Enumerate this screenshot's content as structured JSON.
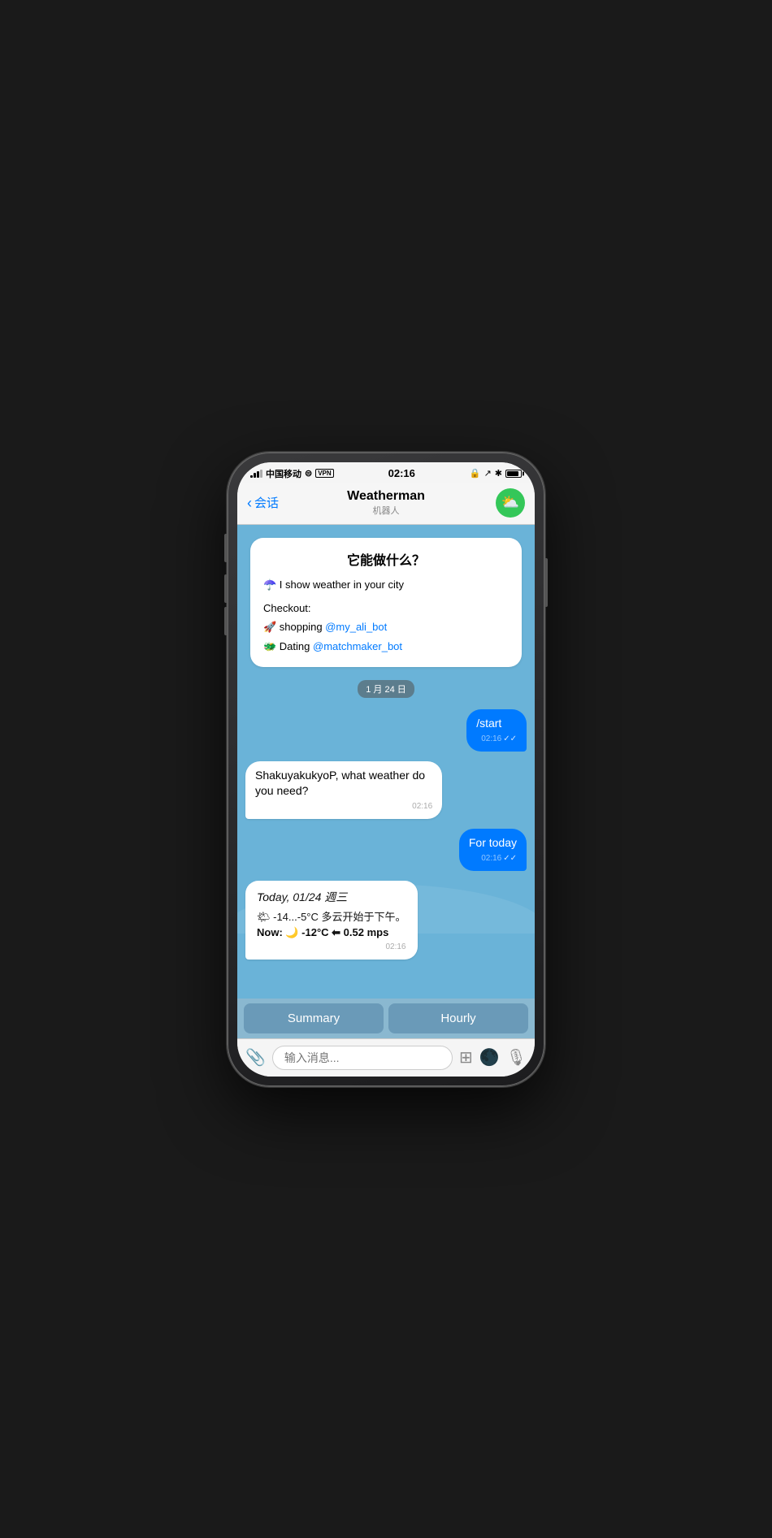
{
  "status_bar": {
    "carrier": "中国移动",
    "wifi": "WiFi",
    "vpn": "VPN",
    "time": "02:16",
    "bluetooth": "✱",
    "location": "↗"
  },
  "nav": {
    "back_label": "会话",
    "title": "Weatherman",
    "subtitle": "机器人"
  },
  "bot_icon": "⛅",
  "chat": {
    "welcome": {
      "title": "它能做什么？",
      "line1": "☂️ I show weather in your city",
      "checkout_label": "Checkout:",
      "checkout_items": [
        {
          "emoji": "🚀",
          "text": "shopping ",
          "link": "@my_ali_bot"
        },
        {
          "emoji": "🐲",
          "text": "Dating ",
          "link": "@matchmaker_bot"
        }
      ]
    },
    "date_divider": "1 月 24 日",
    "messages": [
      {
        "type": "outgoing",
        "text": "/start",
        "time": "02:16",
        "checks": "✓✓"
      },
      {
        "type": "incoming",
        "text": "ShakuyakukyoP, what weather do you need?",
        "time": "02:16"
      },
      {
        "type": "outgoing",
        "text": "For today",
        "time": "02:16",
        "checks": "✓✓"
      }
    ],
    "weather_msg": {
      "date": "Today, 01/24 週三",
      "detail": "🌤 -14...-5°C 多云开始于下午。",
      "now": "Now: 🌙 -12°C ⬅ 0.52 mps",
      "time": "02:16"
    },
    "buttons": [
      {
        "label": "Summary"
      },
      {
        "label": "Hourly"
      }
    ]
  },
  "input": {
    "placeholder": "输入消息..."
  }
}
